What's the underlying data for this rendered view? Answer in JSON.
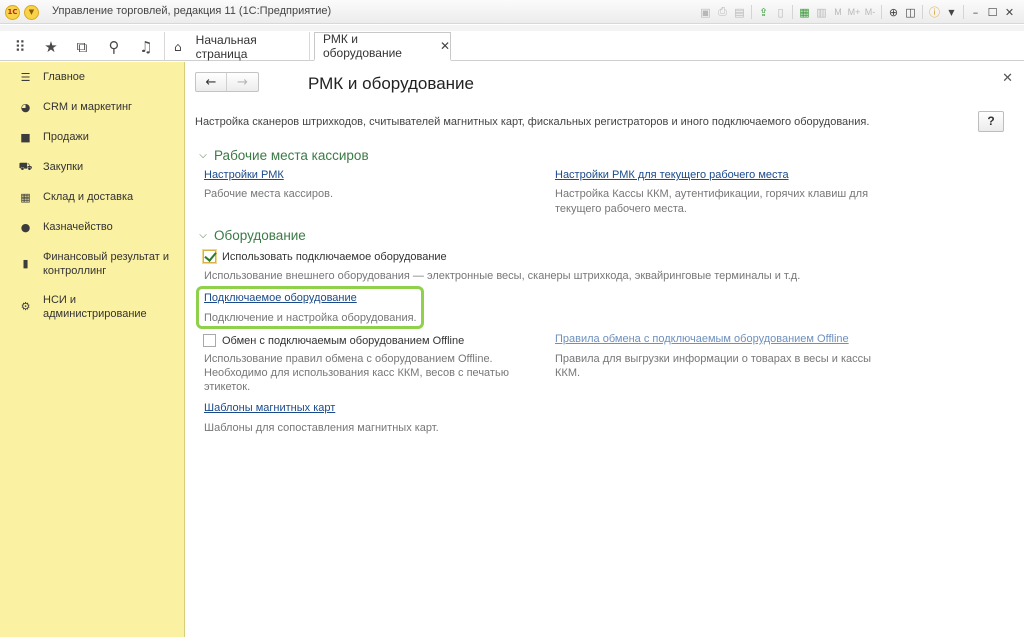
{
  "window": {
    "title": "Управление торговлей, редакция 11  (1С:Предприятие)",
    "logo_text": "1С",
    "toolbar_text": [
      "M",
      "M+",
      "M-"
    ]
  },
  "tabs": [
    {
      "label": "Начальная страница"
    },
    {
      "label": "РМК и оборудование",
      "close": "✕"
    }
  ],
  "sidebar": {
    "items": [
      {
        "label": "Главное",
        "icon": "menu-lines-icon"
      },
      {
        "label": "CRM и маркетинг",
        "icon": "pie-chart-icon"
      },
      {
        "label": "Продажи",
        "icon": "shopping-bag-icon"
      },
      {
        "label": "Закупки",
        "icon": "cart-icon"
      },
      {
        "label": "Склад и доставка",
        "icon": "warehouse-icon"
      },
      {
        "label": "Казначейство",
        "icon": "coin-icon"
      },
      {
        "label": "Финансовый результат и контроллинг",
        "icon": "bar-chart-icon"
      },
      {
        "label": "НСИ и администрирование",
        "icon": "gear-icon"
      }
    ]
  },
  "page": {
    "title": "РМК и оборудование",
    "help_label": "?",
    "description": "Настройка сканеров штрихкодов, считывателей магнитных карт, фискальных регистраторов и иного подключаемого оборудования.",
    "groups": {
      "cashiers": {
        "title": "Рабочие места кассиров",
        "rmk_settings_link": "Настройки РМК",
        "rmk_settings_note": "Рабочие места кассиров.",
        "current_rmk_link": "Настройки РМК для текущего рабочего места",
        "current_rmk_note_1": "Настройка Кассы ККМ, аутентификации, горячих клавиш для",
        "current_rmk_note_2": "текущего рабочего места."
      },
      "equipment": {
        "title": "Оборудование",
        "use_equipment_label": "Использовать подключаемое оборудование",
        "use_equipment_checked": true,
        "use_equipment_note": "Использование внешнего оборудования — электронные весы, сканеры штрихкода, эквайринговые терминалы и т.д.",
        "connected_link": "Подключаемое оборудование",
        "connected_note": "Подключение и настройка оборудования.",
        "offline_label": "Обмен с подключаемым оборудованием Offline",
        "offline_checked": false,
        "offline_note_1": "Использование правил обмена с оборудованием Offline.",
        "offline_note_2": "Необходимо для использования касс ККМ, весов с печатью",
        "offline_note_3": "этикеток.",
        "offline_rules_link": "Правила обмена с подключаемым оборудованием Offline",
        "offline_rules_note_1": "Правила для выгрузки информации о товарах в весы и кассы",
        "offline_rules_note_2": "ККМ.",
        "magnetic_link": "Шаблоны магнитных карт",
        "magnetic_note": "Шаблоны для сопоставления магнитных карт."
      }
    }
  },
  "colors": {
    "sidebar_bg": "#fbf1a2",
    "group_title": "#3c7a47",
    "link": "#1a4a8a",
    "highlight": "#8fd14a"
  }
}
